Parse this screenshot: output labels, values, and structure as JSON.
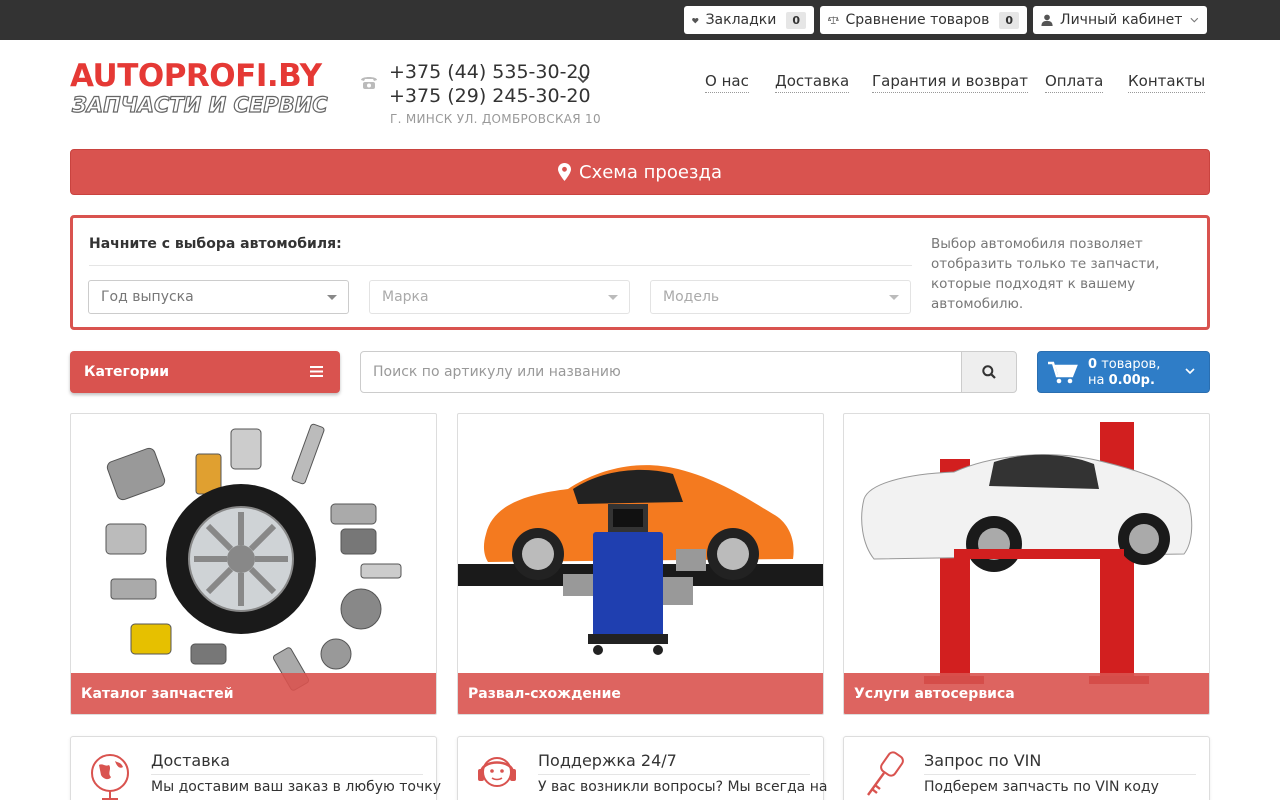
{
  "topbar": {
    "bookmarks_label": "Закладки",
    "bookmarks_count": "0",
    "compare_label": "Сравнение товаров",
    "compare_count": "0",
    "account_label": "Личный кабинет"
  },
  "header": {
    "logo_top": "AUTOPROFI.BY",
    "logo_bottom": "ЗАПЧАСТИ И СЕРВИС",
    "phone1": "+375 (44) 535-30-20",
    "phone2": "+375 (29) 245-30-20",
    "address": "Г. МИНСК УЛ. ДОМБРОВСКАЯ 10",
    "nav": [
      "О нас",
      "Доставка",
      "Гарантия и возврат",
      "Оплата",
      "Контакты"
    ]
  },
  "map_button": {
    "label": "Схема проезда"
  },
  "car_selector": {
    "title": "Начните с выбора автомобиля:",
    "year_placeholder": "Год выпуска",
    "brand_placeholder": "Марка",
    "model_placeholder": "Модель",
    "help": "Выбор автомобиля позволяет отобразить только те запчасти, которые подходят к вашему автомобилю."
  },
  "toolbar": {
    "categories_label": "Категории",
    "search_placeholder": "Поиск по артикулу или названию",
    "cart_count": "0",
    "cart_items_word": "товаров,",
    "cart_prefix": "на",
    "cart_total": "0.00р."
  },
  "cards": [
    {
      "label": "Каталог запчастей"
    },
    {
      "label": "Развал-схождение"
    },
    {
      "label": "Услуги автосервиса"
    }
  ],
  "features": [
    {
      "title": "Доставка",
      "text": "Мы доставим ваш заказ в любую точку"
    },
    {
      "title": "Поддержка 24/7",
      "text": "У вас возникли вопросы? Мы всегда на"
    },
    {
      "title": "Запрос по VIN",
      "text": "Подберем запчасть по VIN коду"
    }
  ],
  "colors": {
    "topbar": "#333333",
    "accent_red": "#d9534f",
    "cart_blue": "#2f7dc7"
  }
}
